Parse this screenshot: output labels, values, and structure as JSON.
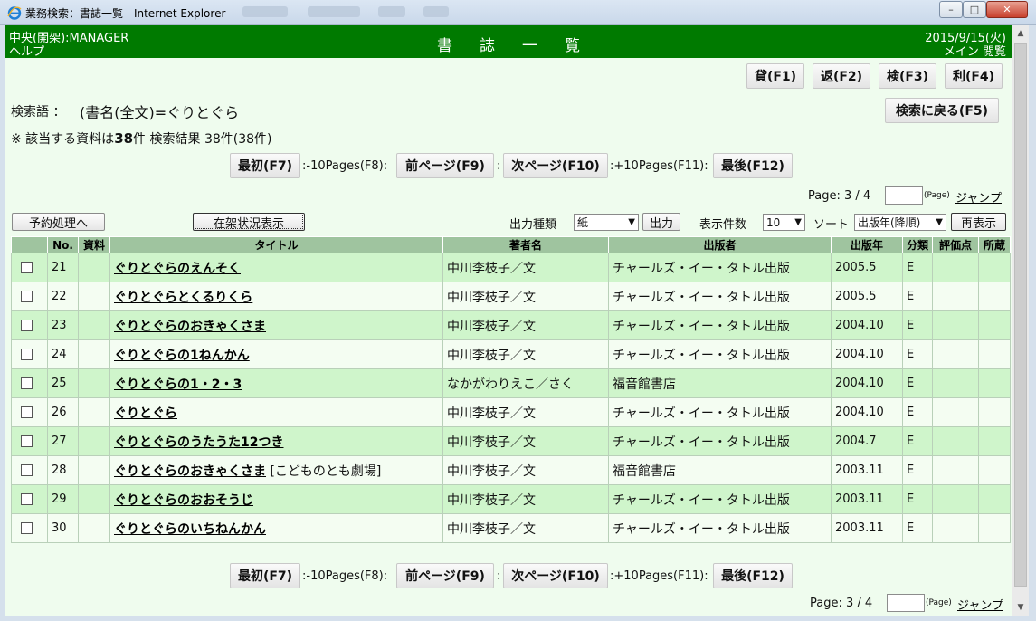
{
  "window": {
    "title": "業務検索：書誌一覧 - Internet Explorer",
    "minimize": "–",
    "maximize": "□",
    "close": "✕"
  },
  "header": {
    "branch": "中央(開架):MANAGER",
    "help": "ヘルプ",
    "title": "書誌一覧",
    "date": "2015/9/15(火)",
    "menu": "メイン",
    "view": "閲覧"
  },
  "toolbar": {
    "lend": "貸(F1)",
    "return": "返(F2)",
    "search": "検(F3)",
    "use": "利(F4)",
    "back_to_search": "検索に戻る(F5)"
  },
  "query": {
    "label": "検索語 ：",
    "expression": "(書名(全文)=ぐりとぐら",
    "note_prefix": "※ 該当する資料は",
    "count": "38",
    "note_suffix": "件 検索結果 38件(38件)"
  },
  "pager": {
    "first": "最初(F7)",
    "minus10": ":-10Pages(F8):",
    "prev": "前ページ(F9)",
    "sep": ":",
    "next": "次ページ(F10)",
    "plus10": ":+10Pages(F11):",
    "last": "最後(F12)",
    "page_label": "Page: 3 / 4",
    "page_unit": "(Page)",
    "jump": "ジャンプ"
  },
  "controls": {
    "reserve": "予約処理へ",
    "shelf_status": "在架状況表示",
    "output_type_label": "出力種類",
    "output_type_value": "紙",
    "output_button": "出力",
    "per_page_label": "表示件数",
    "per_page_value": "10",
    "sort_label": "ソート",
    "sort_value": "出版年(降順)",
    "redisplay": "再表示"
  },
  "table": {
    "headers": [
      "",
      "No.",
      "資料",
      "タイトル",
      "著者名",
      "出版者",
      "出版年",
      "分類",
      "評価点",
      "所蔵"
    ],
    "rows": [
      {
        "no": "21",
        "title": "ぐりとぐらのえんそく",
        "extra": "",
        "author": "中川李枝子／文",
        "publisher": "チャールズ・イー・タトル出版",
        "year": "2005.5",
        "class": "E"
      },
      {
        "no": "22",
        "title": "ぐりとぐらとくるりくら",
        "extra": "",
        "author": "中川李枝子／文",
        "publisher": "チャールズ・イー・タトル出版",
        "year": "2005.5",
        "class": "E"
      },
      {
        "no": "23",
        "title": "ぐりとぐらのおきゃくさま",
        "extra": "",
        "author": "中川李枝子／文",
        "publisher": "チャールズ・イー・タトル出版",
        "year": "2004.10",
        "class": "E"
      },
      {
        "no": "24",
        "title": "ぐりとぐらの1ねんかん",
        "extra": "",
        "author": "中川李枝子／文",
        "publisher": "チャールズ・イー・タトル出版",
        "year": "2004.10",
        "class": "E"
      },
      {
        "no": "25",
        "title": "ぐりとぐらの1・2・3",
        "extra": "",
        "author": "なかがわりえこ／さく",
        "publisher": "福音館書店",
        "year": "2004.10",
        "class": "E"
      },
      {
        "no": "26",
        "title": "ぐりとぐら",
        "extra": "",
        "author": "中川李枝子／文",
        "publisher": "チャールズ・イー・タトル出版",
        "year": "2004.10",
        "class": "E"
      },
      {
        "no": "27",
        "title": "ぐりとぐらのうたうた12つき",
        "extra": "",
        "author": "中川李枝子／文",
        "publisher": "チャールズ・イー・タトル出版",
        "year": "2004.7",
        "class": "E"
      },
      {
        "no": "28",
        "title": "ぐりとぐらのおきゃくさま",
        "extra": "[こどものとも劇場]",
        "author": "中川李枝子／文",
        "publisher": "福音館書店",
        "year": "2003.11",
        "class": "E"
      },
      {
        "no": "29",
        "title": "ぐりとぐらのおおそうじ",
        "extra": "",
        "author": "中川李枝子／文",
        "publisher": "チャールズ・イー・タトル出版",
        "year": "2003.11",
        "class": "E"
      },
      {
        "no": "30",
        "title": "ぐりとぐらのいちねんかん",
        "extra": "",
        "author": "中川李枝子／文",
        "publisher": "チャールズ・イー・タトル出版",
        "year": "2003.11",
        "class": "E"
      }
    ]
  },
  "colors": {
    "header_green": "#007a00",
    "background": "#effcee",
    "row_odd": "#cff5cb",
    "row_even": "#f4fdf2",
    "table_header": "#9fc49f"
  },
  "icons": {
    "browser": "ie-icon",
    "scroll_up": "chevron-up-icon",
    "scroll_down": "chevron-down-icon"
  }
}
